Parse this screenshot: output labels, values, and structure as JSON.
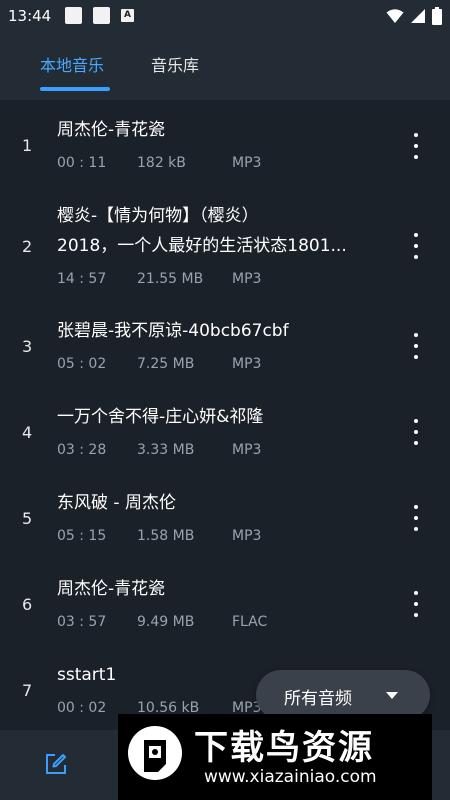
{
  "status_bar": {
    "time": "13:44",
    "notification_icons": [
      "square-icon",
      "square-icon",
      "font-a-icon"
    ],
    "notification_a": "A",
    "right_icons": [
      "wifi-icon",
      "signal-icon",
      "battery-icon"
    ]
  },
  "tabs": [
    {
      "label": "本地音乐",
      "active": true
    },
    {
      "label": "音乐库",
      "active": false
    }
  ],
  "tracks": [
    {
      "index": "1",
      "title": "周杰伦-青花瓷",
      "duration": "00 : 11",
      "size": "182 kB",
      "format": "MP3"
    },
    {
      "index": "2",
      "title_line1": "樱炎-【情为何物】（樱炎）",
      "title_line2": "2018，一个人最好的生活状态1801...",
      "duration": "14 : 57",
      "size": "21.55 MB",
      "format": "MP3"
    },
    {
      "index": "3",
      "title": "张碧晨-我不原谅-40bcb67cbf",
      "duration": "05 : 02",
      "size": "7.25 MB",
      "format": "MP3"
    },
    {
      "index": "4",
      "title": "一万个舍不得-庄心妍&祁隆",
      "duration": "03 : 28",
      "size": "3.33 MB",
      "format": "MP3"
    },
    {
      "index": "5",
      "title": "东风破 - 周杰伦",
      "duration": "05 : 15",
      "size": "1.58 MB",
      "format": "MP3"
    },
    {
      "index": "6",
      "title": "周杰伦-青花瓷",
      "duration": "03 : 57",
      "size": "9.49 MB",
      "format": "FLAC"
    },
    {
      "index": "7",
      "title": "sstart1",
      "duration": "00 : 02",
      "size": "10.56 kB",
      "format": "MP3"
    }
  ],
  "filter": {
    "label": "所有音频",
    "icon": "caret-down-icon"
  },
  "bottom_bar": {
    "icons": [
      "edit-icon"
    ]
  },
  "watermark": {
    "title": "下载鸟资源",
    "url": "www.xiazainiao.com"
  },
  "colors": {
    "accent": "#3aa0ff",
    "background": "#1b2128",
    "bar": "#232b34",
    "muted_text": "#9aa3ad"
  }
}
